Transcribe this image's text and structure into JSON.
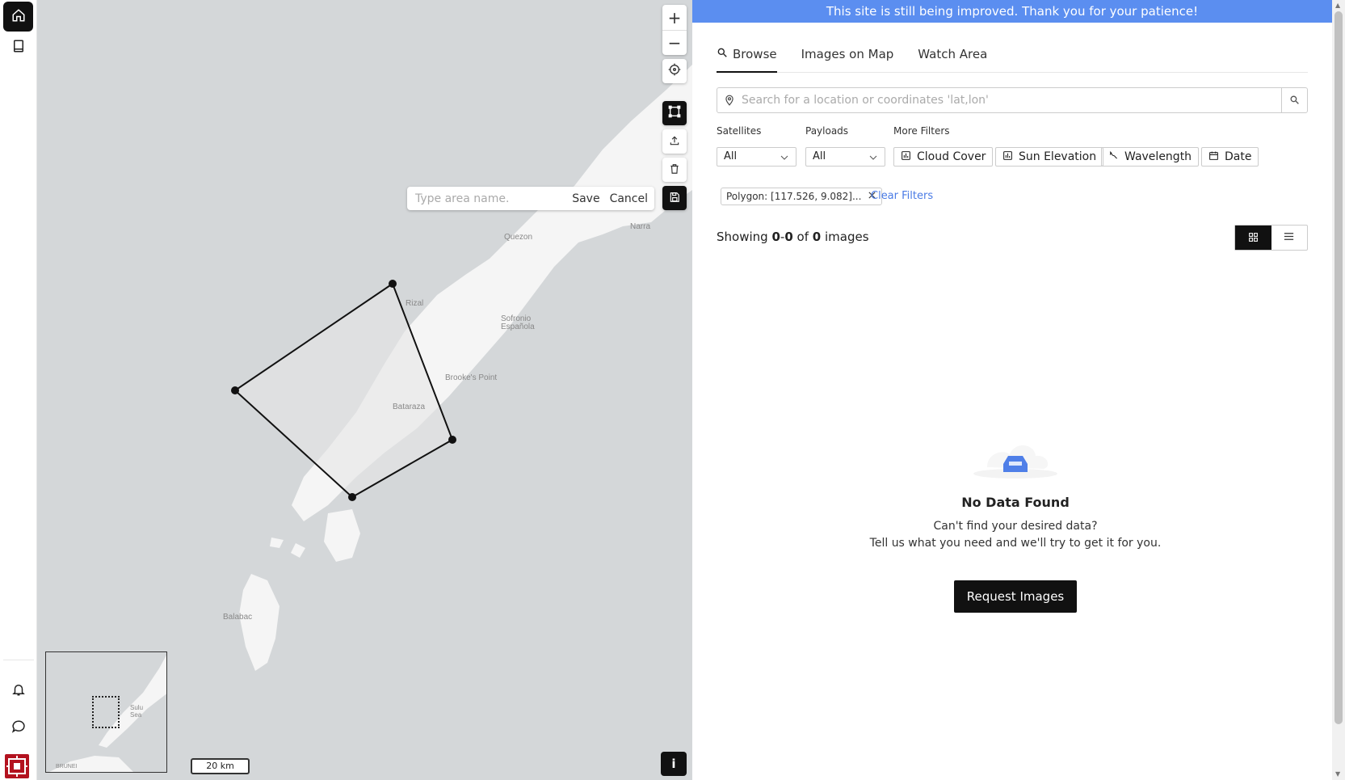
{
  "rail": {
    "home_icon": "home-icon",
    "book_icon": "book-icon",
    "bell_icon": "bell-icon",
    "chat_icon": "chat-icon",
    "accent": "#111111"
  },
  "map": {
    "zoom_in": "+",
    "zoom_out": "−",
    "area_name_placeholder": "Type area name.",
    "save_label": "Save",
    "cancel_label": "Cancel",
    "places": {
      "quezon": "Quezon",
      "narra": "Narra",
      "rizal": "Rizal",
      "sofronio": "Sofronio",
      "espanola": "Española",
      "brookes": "Brooke's Point",
      "bataraza": "Bataraza",
      "balabac": "Balabac"
    },
    "minimap_labels": {
      "sulu": "Sulu",
      "sea": "Sea",
      "brunei": "BRUNEI"
    },
    "scale_label": "20 km",
    "info_label": "i"
  },
  "panel": {
    "banner": "This site is still being improved. Thank you for your patience!",
    "banner_color": "#5b8ef0",
    "tabs": [
      {
        "label": "Browse",
        "active": true
      },
      {
        "label": "Images on Map",
        "active": false
      },
      {
        "label": "Watch Area",
        "active": false
      }
    ],
    "search_placeholder": "Search for a location or coordinates 'lat,lon'",
    "filters": {
      "satellites_label": "Satellites",
      "satellites_value": "All",
      "payloads_label": "Payloads",
      "payloads_value": "All",
      "more_label": "More Filters",
      "cloud_cover": "Cloud Cover",
      "sun_elevation": "Sun Elevation",
      "wavelength": "Wavelength",
      "date": "Date"
    },
    "chip_label": "Polygon: [117.526, 9.082]...",
    "clear_filters": "Clear Filters",
    "showing": {
      "prefix": "Showing",
      "start": "0",
      "dash": "-",
      "end": "0",
      "of": "of",
      "total": "0",
      "suffix": "images"
    },
    "empty": {
      "title": "No Data Found",
      "line1": "Can't find your desired data?",
      "line2": "Tell us what you need and we'll try to get it for you.",
      "button": "Request Images"
    }
  }
}
